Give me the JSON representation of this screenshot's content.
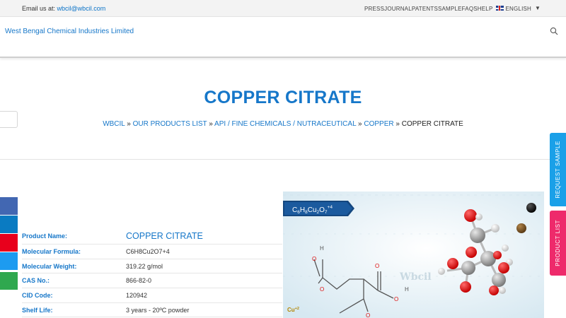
{
  "topbar": {
    "email_label": "Email us at:",
    "email": "wbcil@wbcil.com",
    "links": [
      "PRESS",
      "JOURNAL",
      "PATENTS",
      "SAMPLE",
      "FAQS",
      "HELP"
    ],
    "language": "ENGLISH",
    "dropdown": "▼"
  },
  "header": {
    "brand": "West Bengal Chemical Industries Limited"
  },
  "banner": {
    "title": "COPPER CITRATE",
    "breadcrumb": {
      "items": [
        "WBCIL",
        "OUR PRODUCTS LIST",
        "API / FINE CHEMICALS / NUTRACEUTICAL",
        "COPPER"
      ],
      "separator": "»",
      "current": "COPPER CITRATE"
    }
  },
  "side_tabs": {
    "request_sample": "REQUEST SAMPLE",
    "product_list": "PRODUCT LIST"
  },
  "social_colors": [
    "#4267b2",
    "#0a7bc2",
    "#e8001c",
    "#1d9bf0",
    "#2fa84f"
  ],
  "product": {
    "rows": [
      {
        "label": "Product Name:",
        "value": "COPPER CITRATE"
      },
      {
        "label": "Molecular Formula:",
        "value": "C6H8Cu2O7+4"
      },
      {
        "label": "Molecular Weight:",
        "value": "319.22 g/mol"
      },
      {
        "label": "CAS No.:",
        "value": "866-82-0"
      },
      {
        "label": "CID Code:",
        "value": "120942"
      },
      {
        "label": "Shelf Life:",
        "value": "3 years - 20ºC powder"
      }
    ]
  },
  "image": {
    "formula_main": "C",
    "formula_parts": [
      {
        "t": "6",
        "sub": true
      },
      {
        "t": "H",
        "sub": false
      },
      {
        "t": "8",
        "sub": true
      },
      {
        "t": "Cu",
        "sub": false
      },
      {
        "t": "2",
        "sub": true
      },
      {
        "t": "O",
        "sub": false
      },
      {
        "t": "7",
        "sub": true
      },
      {
        "t": "+4",
        "sup": true
      }
    ],
    "watermark": "Wbcil",
    "atom_h": "H",
    "atom_o": "O",
    "ion_label": "Cu",
    "ion_charge": "+2"
  }
}
